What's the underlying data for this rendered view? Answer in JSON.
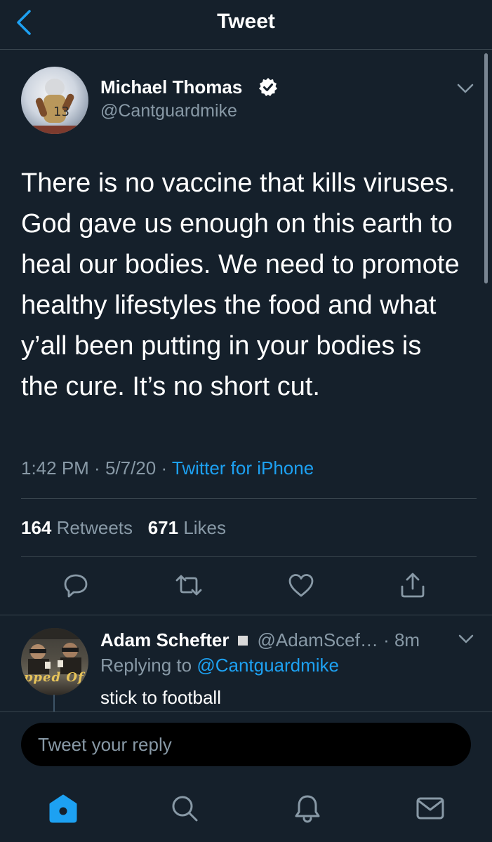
{
  "header": {
    "title": "Tweet",
    "back_icon": "chevron-left-icon"
  },
  "tweet": {
    "author_name": "Michael Thomas",
    "author_handle": "@Cantguardmike",
    "verified": true,
    "text": "There is no vaccine that kills viruses.\nGod gave us enough on this earth to\nheal our bodies. We need to promote\nhealthy lifestyles the food and what\ny’all been putting in your bodies is\nthe cure. It’s no short cut.",
    "time": "1:42 PM",
    "date": "5/7/20",
    "separator": " · ",
    "source": "Twitter for iPhone",
    "retweets_count": "164",
    "retweets_label": "Retweets",
    "likes_count": "671",
    "likes_label": "Likes"
  },
  "actions": [
    "reply-icon",
    "retweet-icon",
    "like-icon",
    "share-icon"
  ],
  "reply": {
    "author_name": "Adam Schefter",
    "handle_time": "@AdamScef… · 8m",
    "replying_prefix": "Replying to ",
    "replying_to": "@Cantguardmike",
    "text": "stick to football",
    "avatar_text": "ipped Of"
  },
  "composer": {
    "placeholder": "Tweet your reply"
  },
  "tabbar": [
    "home-icon",
    "search-icon",
    "notifications-icon",
    "messages-icon"
  ],
  "colors": {
    "background": "#15202b",
    "accent": "#1da1f2",
    "secondary_text": "#8899a6",
    "divider": "#38444d"
  }
}
